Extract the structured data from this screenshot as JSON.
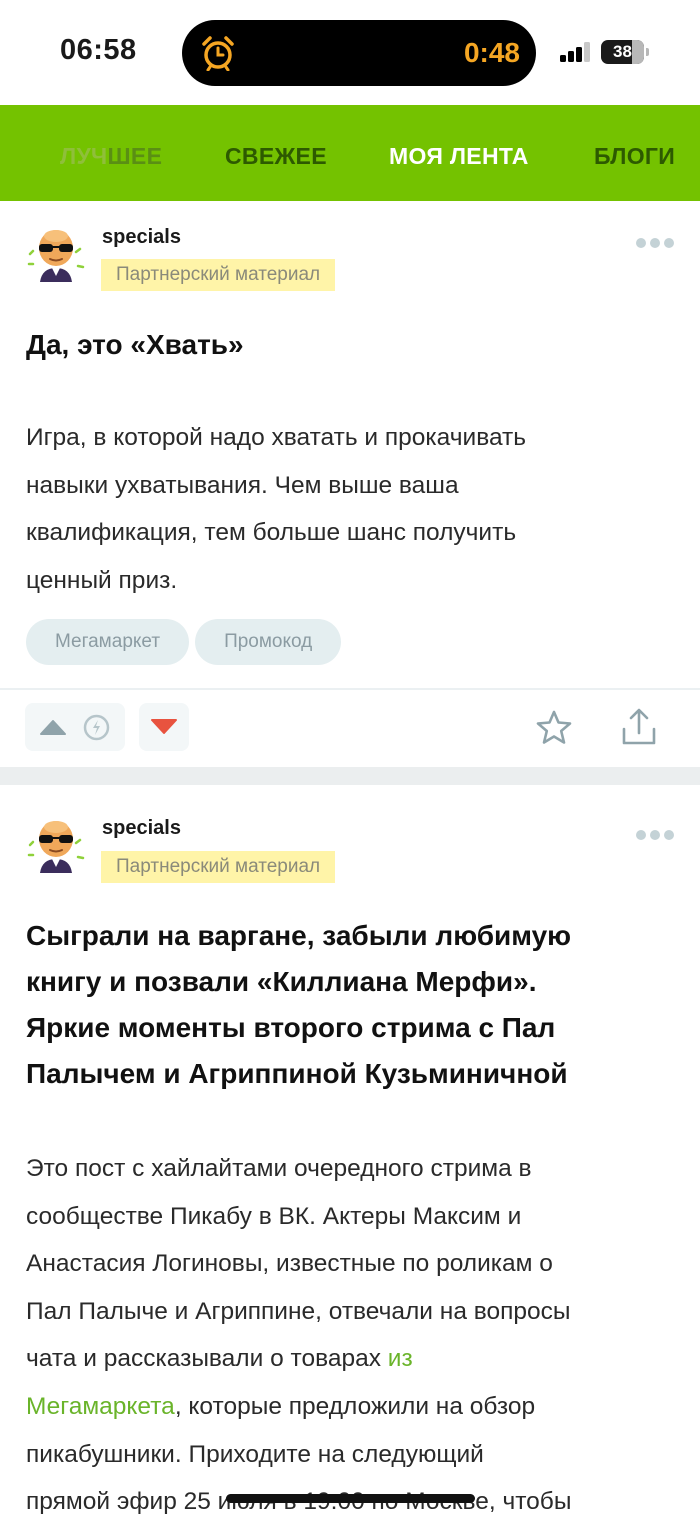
{
  "status_bar": {
    "time": "06:58",
    "timer": "0:48",
    "battery": "38",
    "icons": [
      "alarm-clock-icon",
      "cellular-signal-icon",
      "battery-icon"
    ]
  },
  "nav": {
    "tabs": [
      {
        "label_faded": "ЛУЧ",
        "label_rest": "ШЕЕ"
      },
      {
        "label": "СВЕЖЕЕ"
      },
      {
        "label": "МОЯ ЛЕНТА"
      },
      {
        "label": "БЛОГИ"
      }
    ],
    "colors": {
      "background": "#74c200",
      "active": "#ffffff",
      "inactive": "#2d5a00"
    }
  },
  "posts": [
    {
      "author": "specials",
      "badge": "Партнерский материал",
      "title": "Да, это «Хвать»",
      "body_lines": [
        "Игра, в которой надо хватать и прокачивать",
        "навыки ухватывания. Чем выше ваша",
        "квалификация, тем больше шанс получить",
        "ценный приз."
      ],
      "tags": [
        "Мегамаркет",
        "Промокод"
      ]
    },
    {
      "author": "specials",
      "badge": "Партнерский материал",
      "title_lines": [
        "Сыграли на варгане, забыли любимую",
        "книгу и позвали «Киллиана Мерфи».",
        "Яркие моменты второго стрима с Пал",
        "Палычем и Агриппиной Кузьминичной"
      ],
      "body_lines": [
        "Это пост с хайлайтами очередного стрима в",
        "сообществе Пикабу в ВК. Актеры Максим и",
        "Анастасия Логиновы, известные по роликам о",
        "Пал Палыче и Агриппине, отвечали на вопросы"
      ],
      "body_line5_text": "чата и рассказывали о товарах ",
      "body_line5_link": "из",
      "body_line6_link": "Мегамаркета",
      "body_line6_text": ", которые предложили на обзор",
      "body_lines_end": [
        "пикабушники. Приходите на следующий",
        "прямой эфир 25 июля в 19:00 по Москве, чтобы"
      ]
    }
  ],
  "accent_link_color": "#6ab42a",
  "downvote_color": "#e8533f"
}
